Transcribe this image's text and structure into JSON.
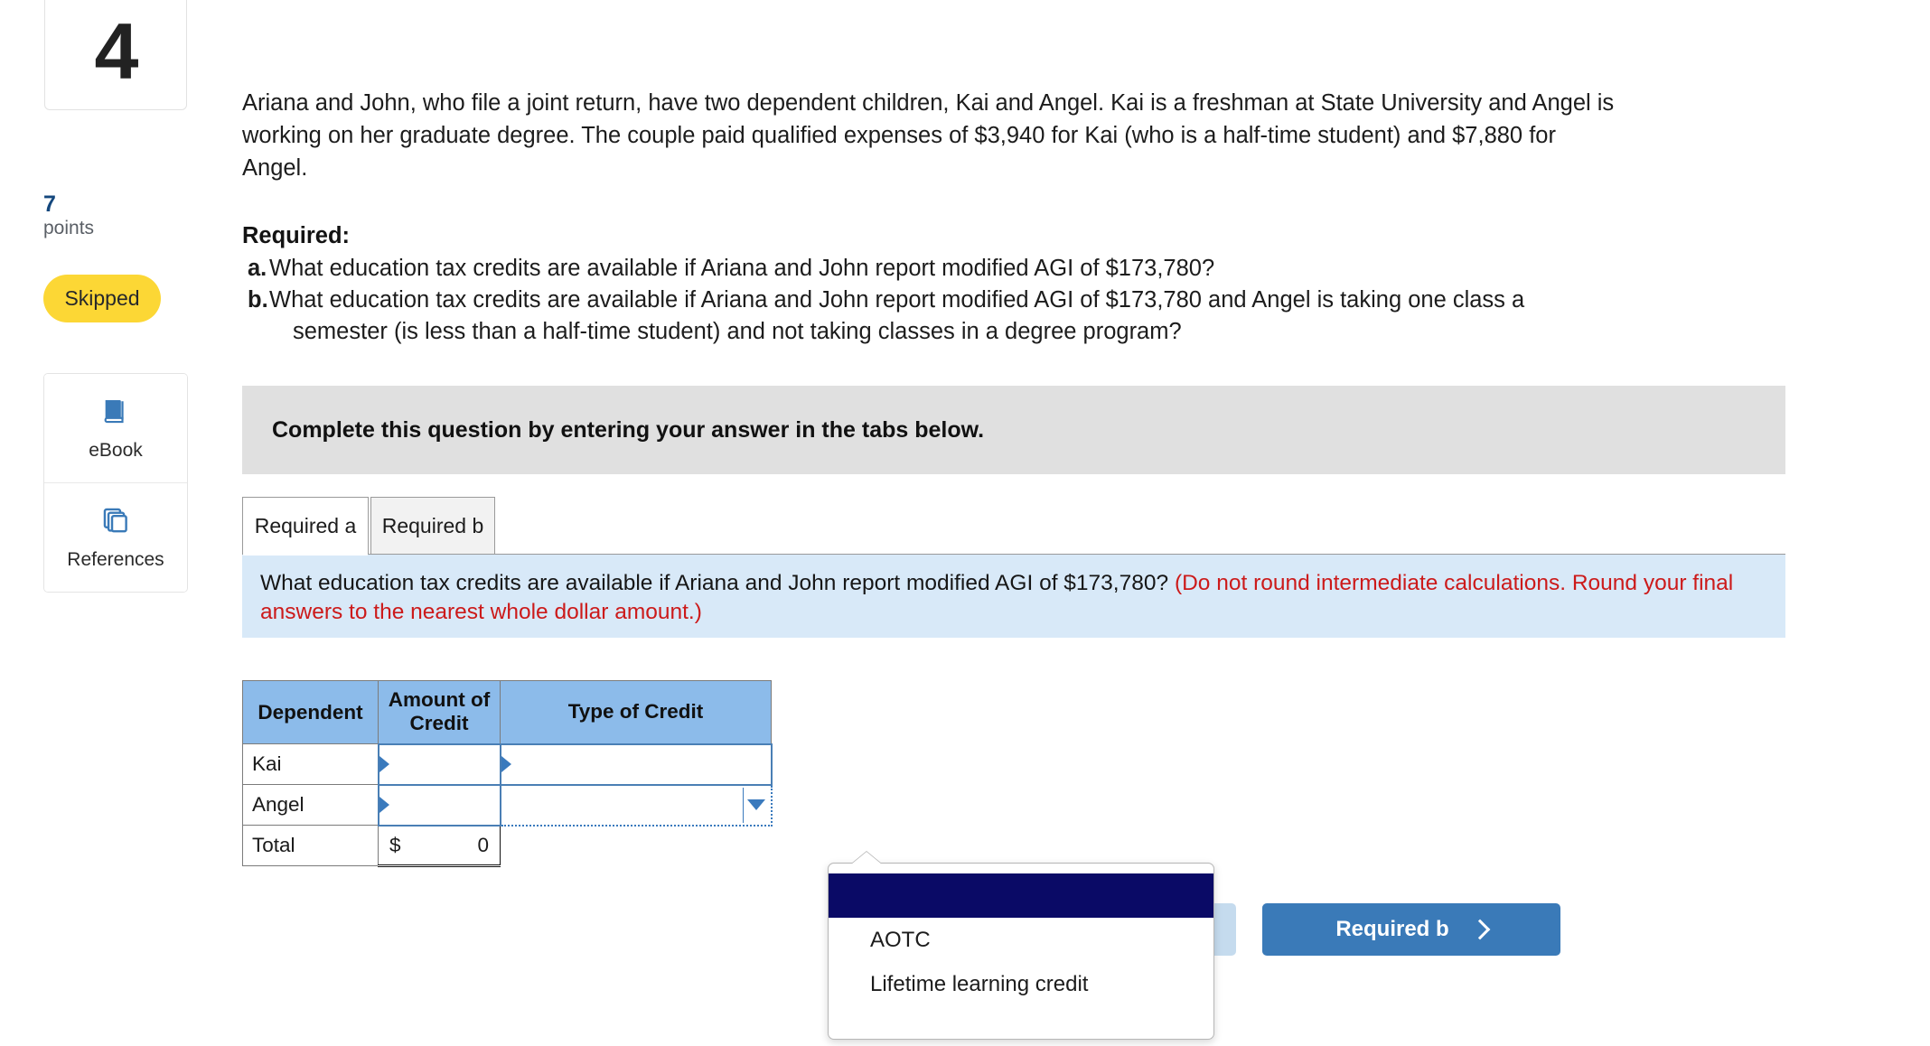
{
  "sidebar": {
    "question_number": "4",
    "points_value": "7",
    "points_label": "points",
    "status_badge": "Skipped",
    "tools": [
      {
        "label": "eBook",
        "icon": "book-icon"
      },
      {
        "label": "References",
        "icon": "copy-stack-icon"
      }
    ]
  },
  "question": {
    "stem_line_1": "Ariana and John, who file a joint return, have two dependent children, Kai and Angel. Kai is a freshman at State University and Angel is",
    "stem_line_2": "working on her graduate degree. The couple paid qualified expenses of $3,940 for Kai (who is a half-time student) and $7,880 for",
    "stem_line_3": "Angel.",
    "required_heading": "Required:",
    "required_items": [
      {
        "marker": "a.",
        "text": "What education tax credits are available if Ariana and John report modified AGI of $173,780?",
        "continuation": ""
      },
      {
        "marker": "b.",
        "text": "What education tax credits are available if Ariana and John report modified AGI of $173,780 and Angel is taking one class a",
        "continuation": "semester (is less than a half-time student) and not taking classes in a degree program?"
      }
    ]
  },
  "banner": {
    "text": "Complete this question by entering your answer in the tabs below."
  },
  "tabs": [
    {
      "label": "Required a",
      "active": true
    },
    {
      "label": "Required b",
      "active": false
    }
  ],
  "panel": {
    "prompt": "What education tax credits are available if Ariana and John report modified AGI of $173,780?",
    "note": "(Do not round intermediate calculations. Round your final answers to the nearest whole dollar amount.)"
  },
  "table": {
    "headers": [
      "Dependent",
      "Amount of Credit",
      "Type of Credit"
    ],
    "header_amount_line_1": "Amount of",
    "header_amount_line_2": "Credit",
    "rows": [
      {
        "dependent": "Kai",
        "amount": "",
        "type": ""
      },
      {
        "dependent": "Angel",
        "amount": "",
        "type": ""
      }
    ],
    "total_row": {
      "dependent": "Total",
      "currency": "$",
      "amount": "0"
    }
  },
  "dropdown": {
    "open": true,
    "options": [
      "",
      "AOTC",
      "Lifetime learning credit"
    ],
    "selected_index": 0
  },
  "footer": {
    "prev_button_label": "",
    "next_button_label": "Required b",
    "next_icon": "chevron-right-icon"
  },
  "colors": {
    "accent_blue": "#3a7ab8",
    "table_header_blue": "#8cbbea",
    "panel_blue": "#d8e9f8",
    "banner_gray": "#e0e0e0",
    "badge_yellow": "#fcd735",
    "note_red": "#cc1a1a",
    "dropdown_selected": "#0a0a66"
  }
}
